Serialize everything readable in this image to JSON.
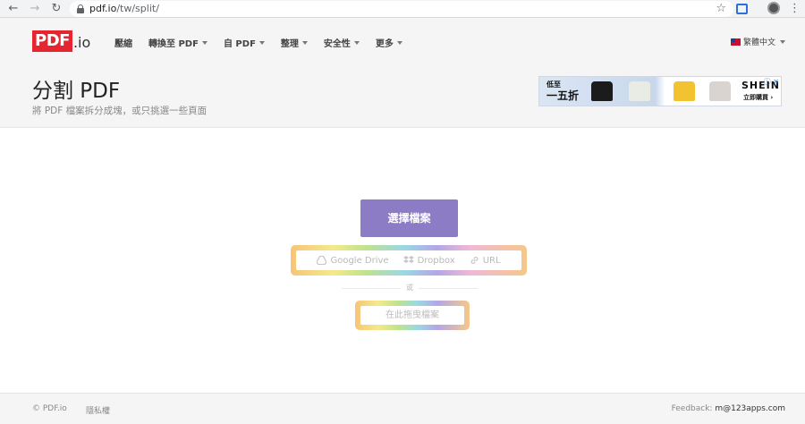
{
  "browser": {
    "url_host": "pdf.io",
    "url_path": "/tw/split/",
    "back_icon": "arrow-left-icon",
    "forward_icon": "arrow-right-icon",
    "reload_icon": "reload-icon",
    "star_icon": "star-icon",
    "menu_icon": "kebab-icon"
  },
  "header": {
    "logo_text": "PDF",
    "logo_suffix": ".io",
    "nav": [
      {
        "label": "壓縮",
        "dropdown": false
      },
      {
        "label": "轉換至 PDF",
        "dropdown": true
      },
      {
        "label": "自 PDF",
        "dropdown": true
      },
      {
        "label": "整理",
        "dropdown": true
      },
      {
        "label": "安全性",
        "dropdown": true
      },
      {
        "label": "更多",
        "dropdown": true
      }
    ],
    "language": "繁體中文",
    "title": "分割 PDF",
    "subtitle": "將 PDF 檔案拆分成塊，或只挑選一些頁面"
  },
  "ad": {
    "line1": "低至",
    "line2": "一五折",
    "brand": "SHEIN",
    "cta": "立即購買 ›"
  },
  "main": {
    "select_button": "選擇檔案",
    "sources": [
      "Google Drive",
      "Dropbox",
      "URL"
    ],
    "or_text": "或",
    "drop_text": "在此拖曳檔案"
  },
  "footer": {
    "copyright": "© PDF.io",
    "privacy": "隱私權",
    "feedback_label": "Feedback: ",
    "feedback_email": "m@123apps.com"
  },
  "colors": {
    "brand_red": "#e3262f",
    "button_purple": "#8c7cc6"
  }
}
